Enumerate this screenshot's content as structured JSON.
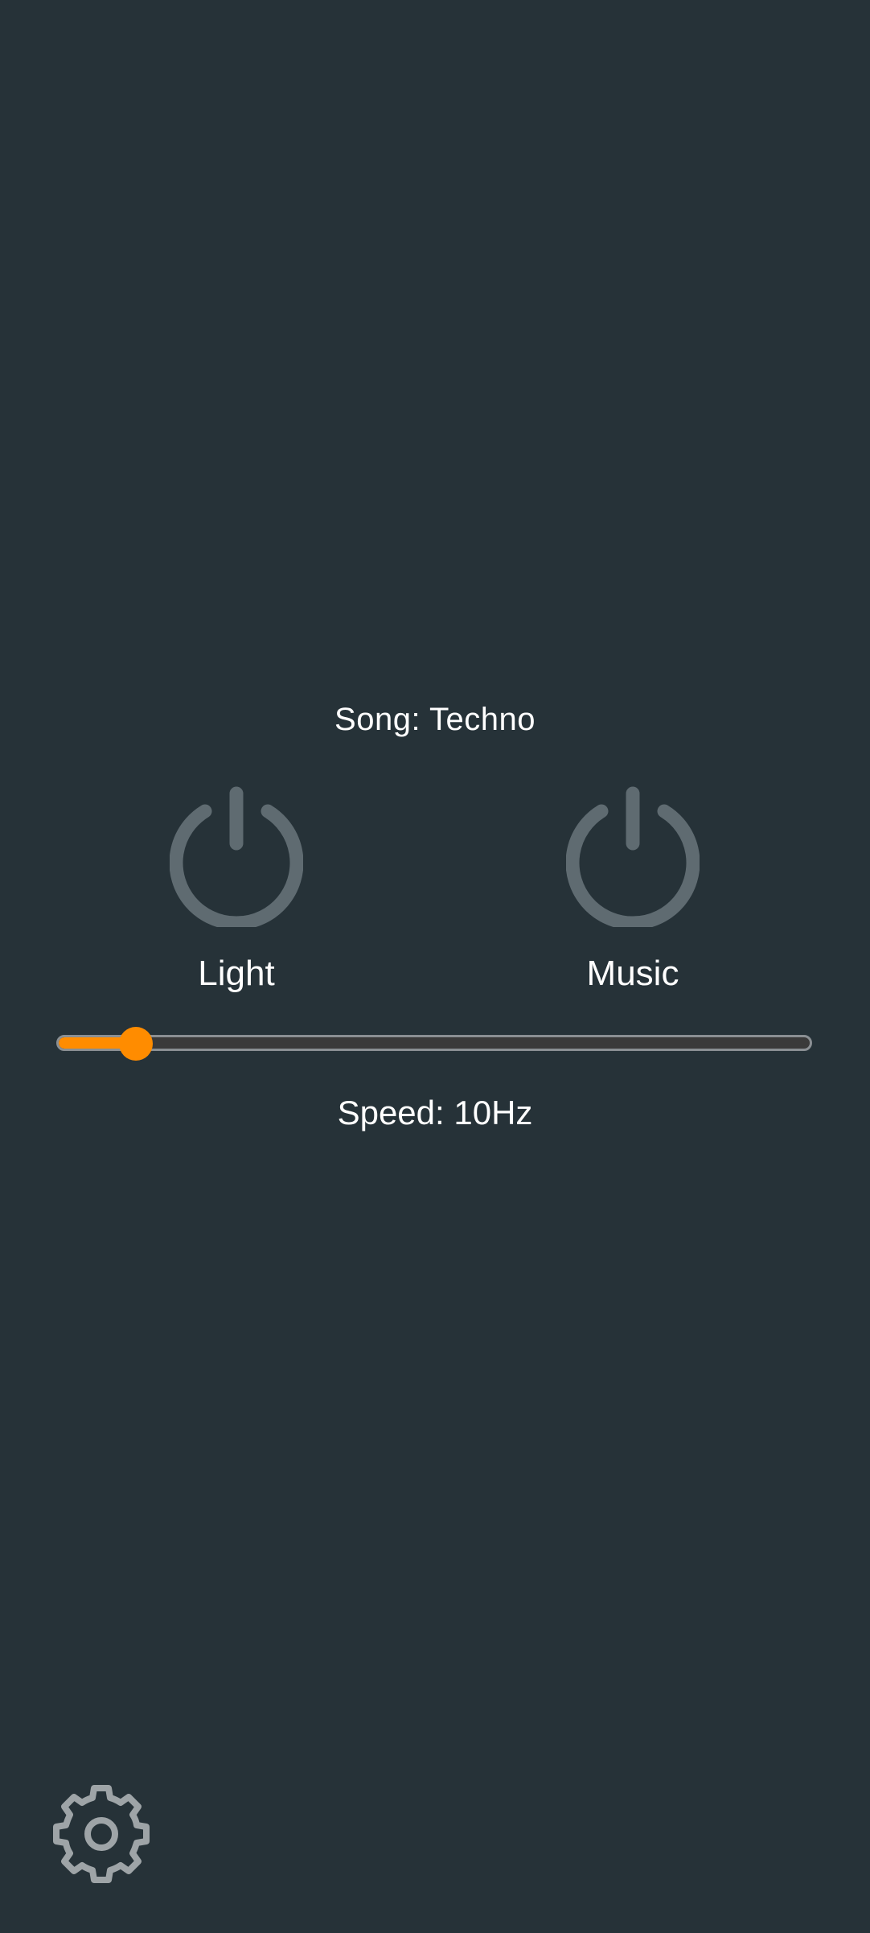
{
  "song": {
    "label": "Song: Techno"
  },
  "toggles": [
    {
      "label": "Light",
      "icon": "power-icon",
      "state": "off"
    },
    {
      "label": "Music",
      "icon": "power-icon",
      "state": "off"
    }
  ],
  "speed": {
    "label": "Speed: 10Hz",
    "level_fraction": 0.105
  },
  "settings": {
    "icon": "gear-icon"
  },
  "colors": {
    "background": "#263238",
    "accent": "#ff8c00",
    "icon_inactive": "#5f6b71",
    "gear": "#9ea4a7",
    "text": "#ffffff"
  }
}
